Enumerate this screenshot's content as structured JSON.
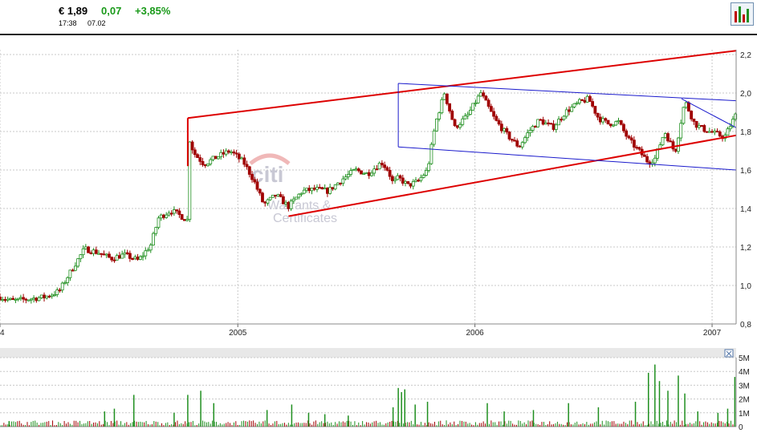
{
  "quote": {
    "price": "€ 1,89",
    "change": "0,07",
    "change_pct": "+3,85%",
    "time": "17:38",
    "date": "07.02",
    "change_color": "#1a9a1a"
  },
  "toolbar": {
    "chart_type_icon": "bar-chart-icon"
  },
  "watermark": {
    "brand": "citi",
    "line1": "Warrants &",
    "line2": "Certificates"
  },
  "chart_data": [
    {
      "type": "line",
      "title": "",
      "ylim": [
        0.8,
        2.2
      ],
      "y_ticks": [
        "0,8",
        "1,0",
        "1,2",
        "1,4",
        "1,6",
        "1,8",
        "2,0",
        "2,2"
      ],
      "x_ticks": [
        "4",
        "2005",
        "2006",
        "2007"
      ],
      "x_tick_dates": [
        "2004-01-01",
        "2005-01-01",
        "2006-01-01",
        "2007-01-01"
      ],
      "xlim": [
        "2004-01-01",
        "2007-02-07"
      ],
      "grid": true,
      "colors": {
        "up": "#1f8f1f",
        "down": "#a00000",
        "trend_red": "#dd0000",
        "trend_blue": "#1a1acc"
      },
      "series": [
        {
          "values_x": [
            "2004-01-01",
            "2004-01-20",
            "2004-02-15",
            "2004-03-10",
            "2004-04-01",
            "2004-04-20",
            "2004-05-10",
            "2004-06-01",
            "2004-06-20",
            "2004-07-10",
            "2004-08-01",
            "2004-08-20",
            "2004-09-01",
            "2004-09-20",
            "2004-10-01",
            "2004-10-15",
            "2004-10-16",
            "2004-10-25",
            "2004-11-10",
            "2004-12-01",
            "2004-12-20",
            "2005-01-10",
            "2005-01-25",
            "2005-02-10",
            "2005-03-01",
            "2005-03-20",
            "2005-04-10",
            "2005-05-01",
            "2005-05-20",
            "2005-06-10",
            "2005-07-01",
            "2005-07-20",
            "2005-08-10",
            "2005-08-20",
            "2005-08-28",
            "2005-09-05",
            "2005-09-20",
            "2005-10-05",
            "2005-10-20",
            "2005-11-01",
            "2005-11-15",
            "2005-12-01",
            "2005-12-20",
            "2006-01-10",
            "2006-02-01",
            "2006-02-20",
            "2006-03-10",
            "2006-03-25",
            "2006-04-10",
            "2006-05-01",
            "2006-05-20",
            "2006-06-10",
            "2006-06-25",
            "2006-07-10",
            "2006-07-25",
            "2006-08-10",
            "2006-08-25",
            "2006-09-10",
            "2006-09-25",
            "2006-10-05",
            "2006-10-20",
            "2006-11-05",
            "2006-11-20",
            "2006-12-05",
            "2006-12-20",
            "2007-01-05",
            "2007-01-20",
            "2007-02-07"
          ],
          "values": [
            0.94,
            0.92,
            0.93,
            0.94,
            0.97,
            1.08,
            1.19,
            1.17,
            1.14,
            1.16,
            1.13,
            1.21,
            1.35,
            1.39,
            1.37,
            1.34,
            1.79,
            1.69,
            1.63,
            1.67,
            1.7,
            1.64,
            1.55,
            1.42,
            1.47,
            1.41,
            1.49,
            1.5,
            1.49,
            1.55,
            1.6,
            1.58,
            1.64,
            1.6,
            1.53,
            1.56,
            1.52,
            1.54,
            1.6,
            1.84,
            2.0,
            1.82,
            1.88,
            2.0,
            1.86,
            1.78,
            1.72,
            1.8,
            1.86,
            1.82,
            1.9,
            1.95,
            1.97,
            1.87,
            1.84,
            1.85,
            1.76,
            1.7,
            1.64,
            1.66,
            1.8,
            1.69,
            1.96,
            1.84,
            1.81,
            1.79,
            1.77,
            1.89
          ]
        }
      ],
      "trendlines": [
        {
          "color": "#dd0000",
          "from": [
            "2004-10-16",
            1.87
          ],
          "to": [
            "2007-02-07",
            2.22
          ]
        },
        {
          "color": "#dd0000",
          "from": [
            "2005-03-20",
            1.36
          ],
          "to": [
            "2007-02-07",
            1.78
          ]
        },
        {
          "color": "#dd0000",
          "from": [
            "2004-10-16",
            1.62
          ],
          "to": [
            "2004-10-16",
            1.87
          ]
        },
        {
          "color": "#1a1acc",
          "from": [
            "2005-09-05",
            2.05
          ],
          "to": [
            "2007-02-07",
            1.96
          ]
        },
        {
          "color": "#1a1acc",
          "from": [
            "2005-09-05",
            1.72
          ],
          "to": [
            "2007-02-07",
            1.6
          ]
        },
        {
          "color": "#1a1acc",
          "from": [
            "2006-11-15",
            1.97
          ],
          "to": [
            "2007-02-07",
            1.82
          ]
        },
        {
          "color": "#1a1acc",
          "from": [
            "2005-09-05",
            2.05
          ],
          "to": [
            "2005-09-05",
            1.72
          ]
        }
      ]
    },
    {
      "type": "bar",
      "title": "",
      "ylim": [
        0,
        5
      ],
      "y_ticks": [
        "0",
        "1M",
        "2M",
        "3M",
        "4M",
        "5M"
      ],
      "y_tick_values": [
        0,
        1,
        2,
        3,
        4,
        5
      ],
      "volume_spikes": [
        {
          "x": "2004-01-15",
          "value": 0.4
        },
        {
          "x": "2004-06-10",
          "value": 1.1
        },
        {
          "x": "2004-06-25",
          "value": 1.3
        },
        {
          "x": "2004-07-25",
          "value": 2.3
        },
        {
          "x": "2004-09-25",
          "value": 1.0
        },
        {
          "x": "2004-10-16",
          "value": 2.3
        },
        {
          "x": "2004-11-05",
          "value": 2.6
        },
        {
          "x": "2004-11-25",
          "value": 1.7
        },
        {
          "x": "2005-02-15",
          "value": 1.2
        },
        {
          "x": "2005-03-25",
          "value": 1.6
        },
        {
          "x": "2005-04-20",
          "value": 1.0
        },
        {
          "x": "2005-05-15",
          "value": 0.9
        },
        {
          "x": "2005-06-20",
          "value": 0.8
        },
        {
          "x": "2005-08-28",
          "value": 1.4
        },
        {
          "x": "2005-09-05",
          "value": 2.8
        },
        {
          "x": "2005-09-10",
          "value": 2.5
        },
        {
          "x": "2005-09-15",
          "value": 2.7
        },
        {
          "x": "2005-10-01",
          "value": 1.6
        },
        {
          "x": "2005-10-20",
          "value": 1.8
        },
        {
          "x": "2006-01-20",
          "value": 1.7
        },
        {
          "x": "2006-02-15",
          "value": 1.1
        },
        {
          "x": "2006-04-01",
          "value": 1.2
        },
        {
          "x": "2006-05-25",
          "value": 1.7
        },
        {
          "x": "2006-07-10",
          "value": 1.4
        },
        {
          "x": "2006-09-05",
          "value": 1.8
        },
        {
          "x": "2006-09-25",
          "value": 3.9
        },
        {
          "x": "2006-10-05",
          "value": 4.5
        },
        {
          "x": "2006-10-12",
          "value": 3.3
        },
        {
          "x": "2006-10-25",
          "value": 2.6
        },
        {
          "x": "2006-11-10",
          "value": 3.7
        },
        {
          "x": "2006-11-20",
          "value": 2.4
        },
        {
          "x": "2006-12-10",
          "value": 1.1
        },
        {
          "x": "2007-01-10",
          "value": 1.0
        },
        {
          "x": "2007-01-25",
          "value": 1.3
        },
        {
          "x": "2007-02-05",
          "value": 3.6
        }
      ]
    }
  ]
}
